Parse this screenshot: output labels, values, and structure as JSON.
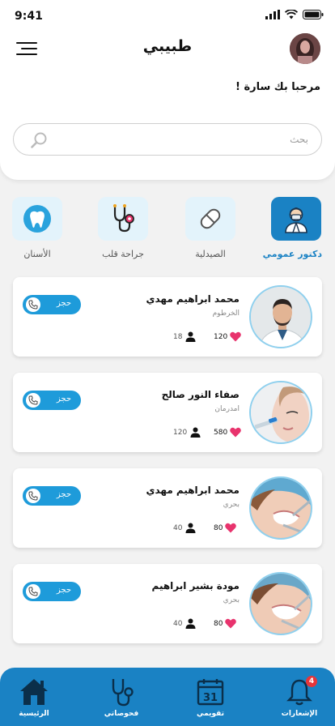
{
  "status": {
    "time": "9:41"
  },
  "header": {
    "title": "طبيبي"
  },
  "greeting": "مرحبا بك سارة !",
  "search": {
    "placeholder": "بحث",
    "value": ""
  },
  "categories": [
    {
      "label": "دكتور عمومي",
      "icon": "doctor-icon",
      "active": true
    },
    {
      "label": "الصيدلية",
      "icon": "pill-icon",
      "active": false
    },
    {
      "label": "جراحة قلب",
      "icon": "stethoscope-icon",
      "active": false
    },
    {
      "label": "الأسنان",
      "icon": "tooth-icon",
      "active": false
    }
  ],
  "doctors": [
    {
      "name": "محمد ابراهيم مهدي",
      "location": "الخرطوم",
      "likes": "120",
      "visits": "18",
      "book_label": "حجز"
    },
    {
      "name": "صفاء النور صالح",
      "location": "امدرمان",
      "likes": "580",
      "visits": "120",
      "book_label": "حجز"
    },
    {
      "name": "محمد ابراهيم مهدي",
      "location": "بحري",
      "likes": "80",
      "visits": "40",
      "book_label": "حجز"
    },
    {
      "name": "مودة بشير ابراهيم",
      "location": "بحري",
      "likes": "80",
      "visits": "40",
      "book_label": "حجز"
    }
  ],
  "nav": {
    "home": "الرئيسية",
    "exams": "فحوصاتي",
    "calendar": "تقويمي",
    "calendar_day": "31",
    "notifications": "الإشعارات",
    "notifications_count": "4"
  },
  "colors": {
    "primary": "#1a82c4",
    "button": "#1e9bda",
    "heart": "#e8336d",
    "badge": "#e6353a",
    "category_bg": "#e3f3fb"
  }
}
